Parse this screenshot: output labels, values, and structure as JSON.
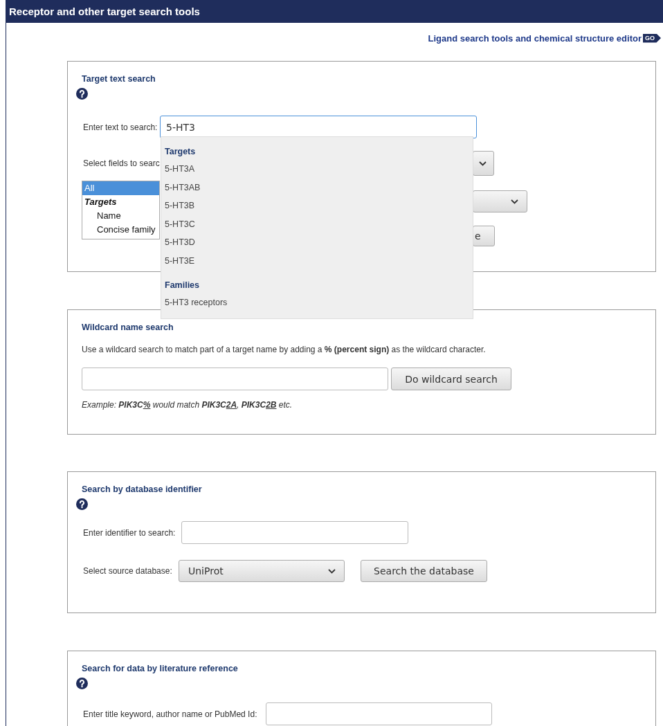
{
  "header": {
    "title": "Receptor and other target search tools"
  },
  "ligand_link": {
    "label": "Ligand search tools and chemical structure editor",
    "badge": "GO"
  },
  "target_search": {
    "title": "Target text search",
    "search_label": "Enter text to search:",
    "search_value": "5-HT3",
    "fields_label": "Select fields to searc",
    "field_list": [
      {
        "label": "All",
        "kind": "option",
        "selected": true
      },
      {
        "label": "Targets",
        "kind": "group",
        "selected": false
      },
      {
        "label": "Name",
        "kind": "option",
        "selected": false
      },
      {
        "label": "Concise family",
        "kind": "option",
        "selected": false
      }
    ],
    "partial_button": "e",
    "suggestions": [
      {
        "heading": "Targets",
        "items": [
          "5-HT3A",
          "5-HT3AB",
          "5-HT3B",
          "5-HT3C",
          "5-HT3D",
          "5-HT3E"
        ]
      },
      {
        "heading": "Families",
        "items": [
          "5-HT3 receptors"
        ]
      }
    ]
  },
  "wildcard_search": {
    "title": "Wildcard name search",
    "description": "Use a wildcard search to match part of a target name by adding a **% (percent sign)** as the wildcard character.",
    "button": "Do wildcard search",
    "example": [
      {
        "text": "Example: ",
        "bold": false,
        "underline": false
      },
      {
        "text": "PIK3C",
        "bold": true,
        "underline": false
      },
      {
        "text": "%",
        "bold": true,
        "underline": true
      },
      {
        "text": " would match ",
        "bold": false,
        "underline": false
      },
      {
        "text": "PIK3C",
        "bold": true,
        "underline": false
      },
      {
        "text": "2A",
        "bold": true,
        "underline": true
      },
      {
        "text": ", ",
        "bold": false,
        "underline": false
      },
      {
        "text": "PIK3C",
        "bold": true,
        "underline": false
      },
      {
        "text": "2B",
        "bold": true,
        "underline": true
      },
      {
        "text": " etc.",
        "bold": false,
        "underline": false
      }
    ]
  },
  "identifier_search": {
    "title": "Search by database identifier",
    "input_label": "Enter identifier to search:",
    "database_label": "Select source database:",
    "database": "UniProt",
    "button": "Search the database"
  },
  "reference_search": {
    "title": "Search for data by literature reference",
    "input_label": "Enter title keyword, author name or PubMed Id:"
  }
}
